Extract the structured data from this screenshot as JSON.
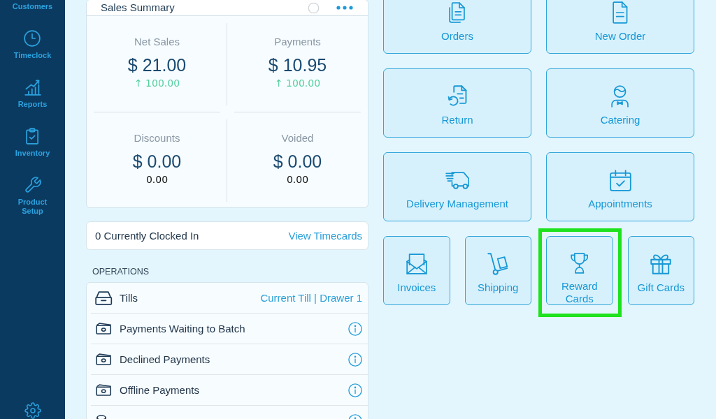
{
  "sidebar": {
    "items": [
      {
        "label": "Customers",
        "selected": false
      },
      {
        "label": "Timeclock",
        "selected": false
      },
      {
        "label": "Reports",
        "selected": false
      },
      {
        "label": "Inventory",
        "selected": false
      },
      {
        "label": "Product Setup",
        "selected": false
      }
    ]
  },
  "sales_summary": {
    "title": "Sales Summary",
    "metrics": [
      {
        "label": "Net Sales",
        "value": "$ 21.00",
        "sub": "↑ 100.00",
        "kind": "trend"
      },
      {
        "label": "Payments",
        "value": "$ 10.95",
        "sub": "↑ 100.00",
        "kind": "trend"
      },
      {
        "label": "Discounts",
        "value": "$ 0.00",
        "sub": "0.00",
        "kind": "amount"
      },
      {
        "label": "Voided",
        "value": "$ 0.00",
        "sub": "0.00",
        "kind": "amount"
      }
    ]
  },
  "clocked_in": {
    "text": "0 Currently Clocked In",
    "link": "View Timecards"
  },
  "operations": {
    "heading": "OPERATIONS",
    "rows": [
      {
        "label": "Tills",
        "kind": "detail",
        "detail": "Current Till | Drawer 1"
      },
      {
        "label": "Payments Waiting to Batch",
        "kind": "info"
      },
      {
        "label": "Declined Payments",
        "kind": "info"
      },
      {
        "label": "Offline Payments",
        "kind": "info"
      },
      {
        "kind": "info"
      }
    ]
  },
  "tiles": [
    {
      "label": "Orders",
      "kind": "wide",
      "highlighted": false
    },
    {
      "label": "New Order",
      "kind": "wide",
      "highlighted": false
    },
    {
      "label": "Return",
      "kind": "wide",
      "highlighted": false
    },
    {
      "label": "Catering",
      "kind": "wide",
      "highlighted": false
    },
    {
      "label": "Delivery Management",
      "kind": "wide",
      "highlighted": false
    },
    {
      "label": "Appointments",
      "kind": "wide",
      "highlighted": false
    },
    {
      "label": "Invoices",
      "kind": "small",
      "highlighted": false
    },
    {
      "label": "Shipping",
      "kind": "small",
      "highlighted": false
    },
    {
      "label": "Reward Cards",
      "kind": "small",
      "highlighted": true
    },
    {
      "label": "Gift Cards",
      "kind": "small",
      "highlighted": false
    }
  ]
}
